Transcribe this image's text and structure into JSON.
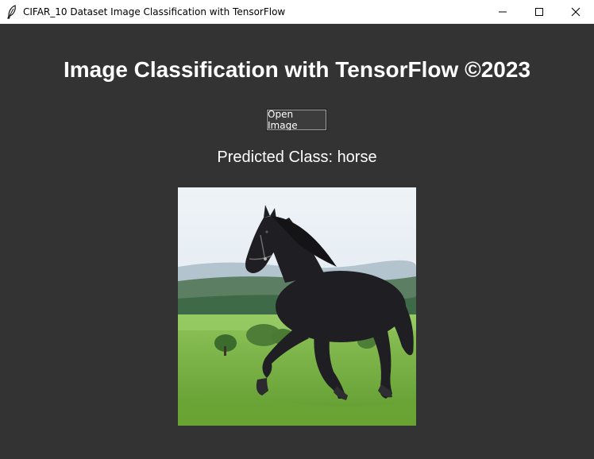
{
  "window": {
    "title": "CIFAR_10 Dataset Image Classification with TensorFlow",
    "controls": [
      "minimize",
      "maximize",
      "close"
    ]
  },
  "main": {
    "heading": "Image Classification with TensorFlow ©2023",
    "open_button_label": "Open Image",
    "prediction_text": "Predicted Class: horse",
    "image": {
      "subject": "black horse trotting on green field"
    }
  },
  "colors": {
    "background": "#333333",
    "text": "#ffffff",
    "titlebar": "#ffffff"
  },
  "icons": {
    "app": "feather-icon",
    "minimize": "minimize-icon",
    "maximize": "maximize-icon",
    "close": "close-icon"
  }
}
